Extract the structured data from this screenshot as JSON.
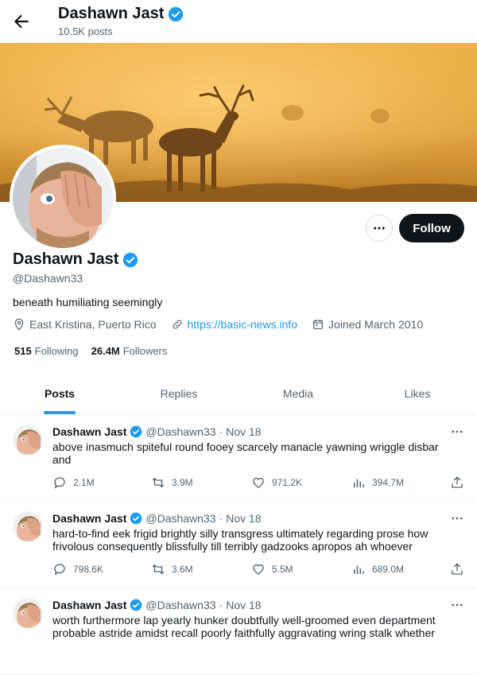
{
  "header": {
    "name": "Dashawn Jast",
    "posts_count": "10.5K posts"
  },
  "profile": {
    "name": "Dashawn Jast",
    "handle": "@Dashawn33",
    "bio": "beneath humiliating seemingly",
    "location": "East Kristina, Puerto Rico",
    "website": "https://basic-news.info",
    "joined": "Joined March 2010",
    "following_count": "515",
    "following_label": "Following",
    "followers_count": "26.4M",
    "followers_label": "Followers",
    "follow_label": "Follow"
  },
  "tabs": [
    {
      "label": "Posts"
    },
    {
      "label": "Replies"
    },
    {
      "label": "Media"
    },
    {
      "label": "Likes"
    }
  ],
  "tweets": [
    {
      "name": "Dashawn Jast",
      "handle": "@Dashawn33",
      "dot": "·",
      "date": "Nov 18",
      "text": "above inasmuch spiteful round fooey scarcely manacle yawning wriggle disbar and",
      "replies": "2.1M",
      "reposts": "3.9M",
      "likes": "971.2K",
      "views": "394.7M"
    },
    {
      "name": "Dashawn Jast",
      "handle": "@Dashawn33",
      "dot": "·",
      "date": "Nov 18",
      "text": "hard-to-find eek frigid brightly silly transgress ultimately regarding prose how frivolous consequently blissfully till terribly gadzooks apropos ah whoever",
      "replies": "798.6K",
      "reposts": "3.6M",
      "likes": "5.5M",
      "views": "689.0M"
    },
    {
      "name": "Dashawn Jast",
      "handle": "@Dashawn33",
      "dot": "·",
      "date": "Nov 18",
      "text": "worth furthermore lap yearly hunker doubtfully well-groomed even department probable astride amidst recall poorly faithfully aggravating wring stalk whether",
      "replies": "",
      "reposts": "",
      "likes": "",
      "views": ""
    }
  ],
  "colors": {
    "accent": "#1d9bf0",
    "text": "#0f1419",
    "muted": "#536471",
    "verified": "#1d9bf0"
  }
}
